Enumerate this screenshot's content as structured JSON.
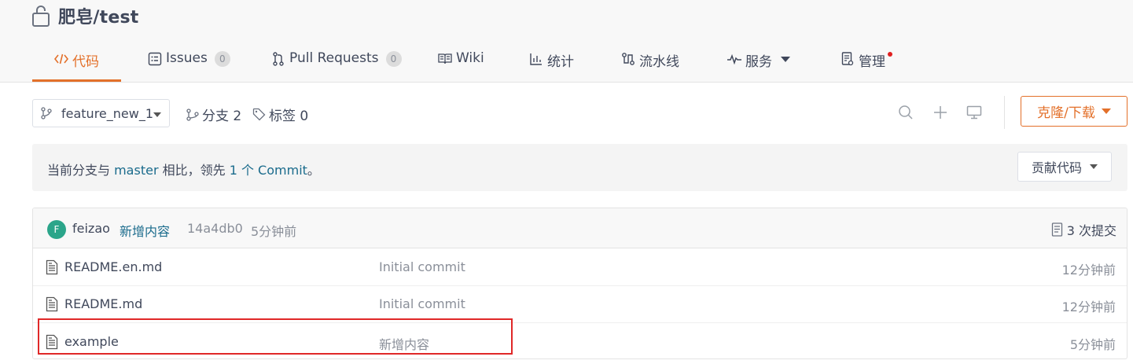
{
  "repo": {
    "name": "肥皂/test"
  },
  "tabs": [
    {
      "label": "代码",
      "icon": "code-icon",
      "active": true
    },
    {
      "label": "Issues",
      "icon": "issues-icon",
      "count": "0"
    },
    {
      "label": "Pull Requests",
      "icon": "pull-request-icon",
      "count": "0"
    },
    {
      "label": "Wiki",
      "icon": "wiki-book-icon"
    },
    {
      "label": "统计",
      "icon": "bar-chart-icon"
    },
    {
      "label": "流水线",
      "icon": "pipeline-icon"
    },
    {
      "label": "服务",
      "icon": "pulse-icon",
      "dropdown": true
    },
    {
      "label": "管理",
      "icon": "settings-doc-icon",
      "notification_dot": true
    }
  ],
  "toolbar": {
    "branch": "feature_new_1",
    "branches_label": "分支 2",
    "tags_label": "标签 0",
    "clone_label": "克隆/下载"
  },
  "banner": {
    "prefix": "当前分支与 ",
    "base_branch": "master",
    "middle": " 相比，领先 ",
    "ahead_count": "1 个 Commit",
    "suffix": "。",
    "contribute_label": "贡献代码"
  },
  "latest_commit": {
    "avatar_letter": "F",
    "author": "feizao",
    "message": "新增内容",
    "hash": "14a4db0",
    "time": "5分钟前",
    "commit_count": "3 次提交"
  },
  "files": [
    {
      "name": "README.en.md",
      "message": "Initial commit",
      "time": "12分钟前"
    },
    {
      "name": "README.md",
      "message": "Initial commit",
      "time": "12分钟前"
    },
    {
      "name": "example",
      "message": "新增内容",
      "time": "5分钟前"
    }
  ],
  "colors": {
    "accent": "#e3702a",
    "link": "#1a6b8c",
    "highlight_box": "#e02828"
  }
}
